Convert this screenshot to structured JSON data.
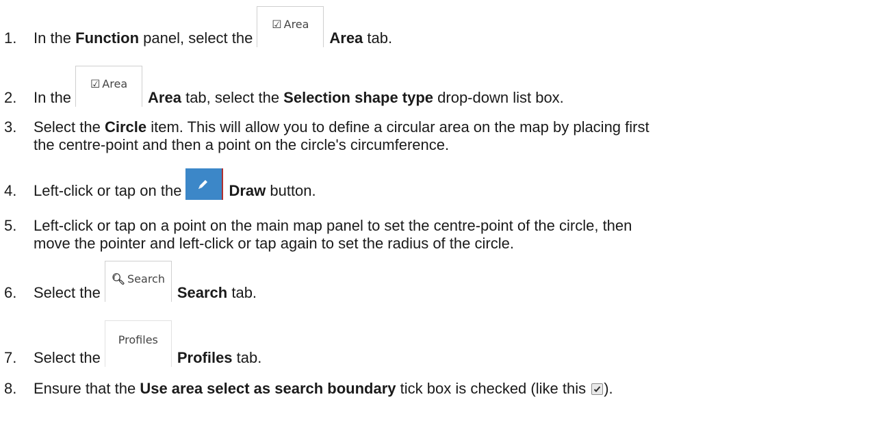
{
  "steps": [
    {
      "number": "1.",
      "before": "In the ",
      "bold1": "Function",
      "middle": " panel, select the",
      "tab_label": "Area",
      "tab_icon": "edit-square-icon",
      "bold2": "Area",
      "after": " tab."
    },
    {
      "number": "2.",
      "before": "In the",
      "tab_label": "Area",
      "tab_icon": "edit-square-icon",
      "bold1": "Area",
      "middle": " tab, select the ",
      "bold2": "Selection shape type",
      "after": " drop-down list box."
    },
    {
      "number": "3.",
      "before": "Select the ",
      "bold1": "Circle",
      "line1_after": " item. This will allow you to define a circular area on the map by placing first",
      "line2": "the centre-point and then a point on the circle's circumference."
    },
    {
      "number": "4.",
      "before": "Left-click or tap on the",
      "button_icon": "pencil-icon",
      "bold1": "Draw",
      "after": " button."
    },
    {
      "number": "5.",
      "line1": "Left-click or tap on a point on the main map panel to set the centre-point of the circle, then",
      "line2": "move the pointer and left-click or tap again to set the radius of the circle."
    },
    {
      "number": "6.",
      "before": "Select the",
      "tab_label": "Search",
      "tab_icon": "search-icon",
      "bold1": "Search",
      "after": " tab."
    },
    {
      "number": "7.",
      "before": "Select the",
      "tab_label": "Profiles",
      "bold1": "Profiles",
      "after": " tab."
    },
    {
      "number": "8.",
      "before": "Ensure that the ",
      "bold1": "Use area select as search boundary",
      "middle": " tick box is checked (like this ",
      "checkbox_icon": "checked-checkbox-icon",
      "after": ")."
    }
  ],
  "colors": {
    "text": "#1a1a1a",
    "draw_button": "#3c87c8",
    "tab_border": "#cfcfcf"
  }
}
